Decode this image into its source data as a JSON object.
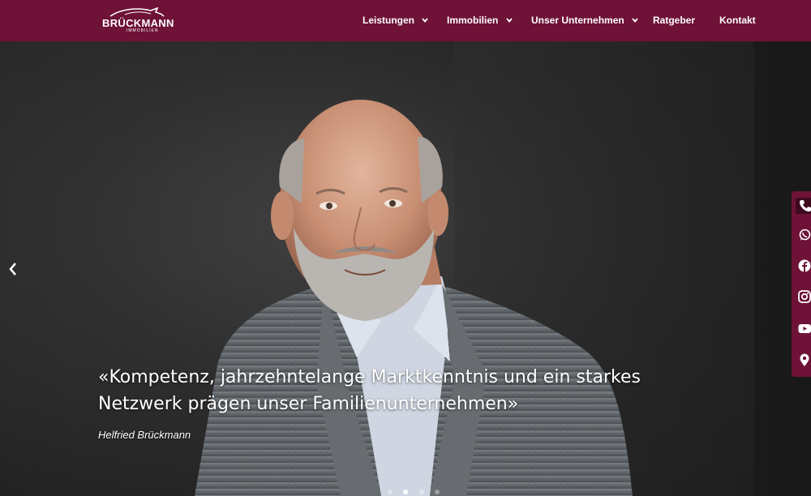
{
  "brand": {
    "name": "BRÜCKMANN",
    "tagline": "IMMOBILIEN"
  },
  "nav": {
    "leistungen": "Leistungen",
    "immobilien": "Immobilien",
    "unternehmen": "Unser Unternehmen",
    "ratgeber": "Ratgeber",
    "kontakt": "Kontakt"
  },
  "hero": {
    "quote_line1": "«Kompetenz, jahrzehntelange Marktkenntnis und ein starkes",
    "quote_line2": "Netzwerk prägen unser Familienunternehmen»",
    "author": "Helfried Brückmann",
    "slides_total": 4,
    "slide_active": 2
  },
  "sidebar": {
    "icons": [
      "phone-icon",
      "whatsapp-icon",
      "facebook-icon",
      "instagram-icon",
      "youtube-icon",
      "location-icon"
    ]
  },
  "colors": {
    "brand": "#6e1237",
    "brand_dark": "#3d0a1e",
    "text": "#ffffff"
  }
}
